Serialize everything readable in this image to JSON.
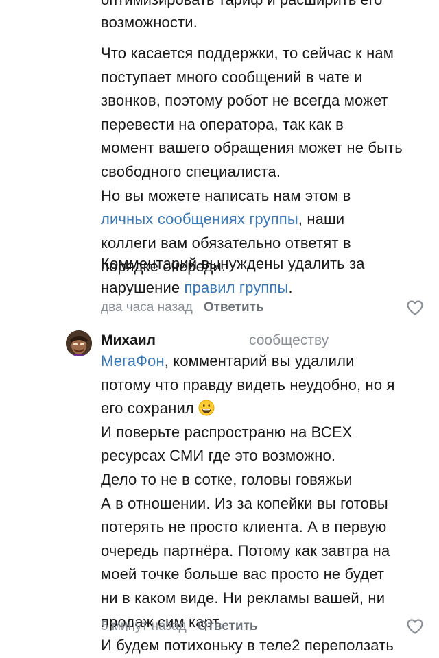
{
  "comment1": {
    "top_clipped": "оптимизировать тариф и расширить его",
    "p1": [
      "возможности."
    ],
    "p2": [
      "Что касается поддержки, то сейчас к нам",
      "поступает много сообщений в чате и",
      "звонков, поэтому робот не всегда может",
      "перевести на оператора, так как в",
      "момент вашего обращения может не быть",
      "свободного специалиста.",
      "Но вы можете написать нам этом в"
    ],
    "p2_link": "личных сообщениях группы",
    "p2_after_link": ", наши",
    "p2_tail": [
      "коллеги вам обязательно ответят в",
      "порядке очереди."
    ],
    "p3_line1": "Комментарий вынуждены удалить за",
    "p3_line2_before": "нарушение ",
    "p3_link": "правил группы",
    "p3_line2_after": ".",
    "time": "два часа назад",
    "reply_label": "Ответить"
  },
  "comment2": {
    "author": "Михаил",
    "to": "сообществу",
    "mention": "МегаФон",
    "line1_rest": ", комментарий вы удалили",
    "lines_a": [
      "потому что правду видеть неудобно, но я"
    ],
    "line_emoji": "его сохранил",
    "lines_b": [
      "И поверьте распространю на ВСЕХ",
      "ресурсах СМИ где это возможно.",
      "Дело то не в сотке, головы говяжьи",
      "А в отношении. Из за копейки вы готовы",
      "потерять не просто клиента. А в первую",
      "очередь партнёра. Потому как завтра на",
      "моей точке больше вас просто не будет",
      "ни в каком виде. Ни рекламы вашей, ни",
      "продаж сим карт",
      "И будем потихоньку в теле2 переползать"
    ],
    "time": "5 минут назад",
    "reply_label": "Ответить"
  },
  "icons": {
    "like": "heart-icon",
    "emoji": "grinning-face-icon",
    "avatar": "user-avatar"
  },
  "colors": {
    "link": "#2a5885",
    "meta": "#8a8f96"
  }
}
